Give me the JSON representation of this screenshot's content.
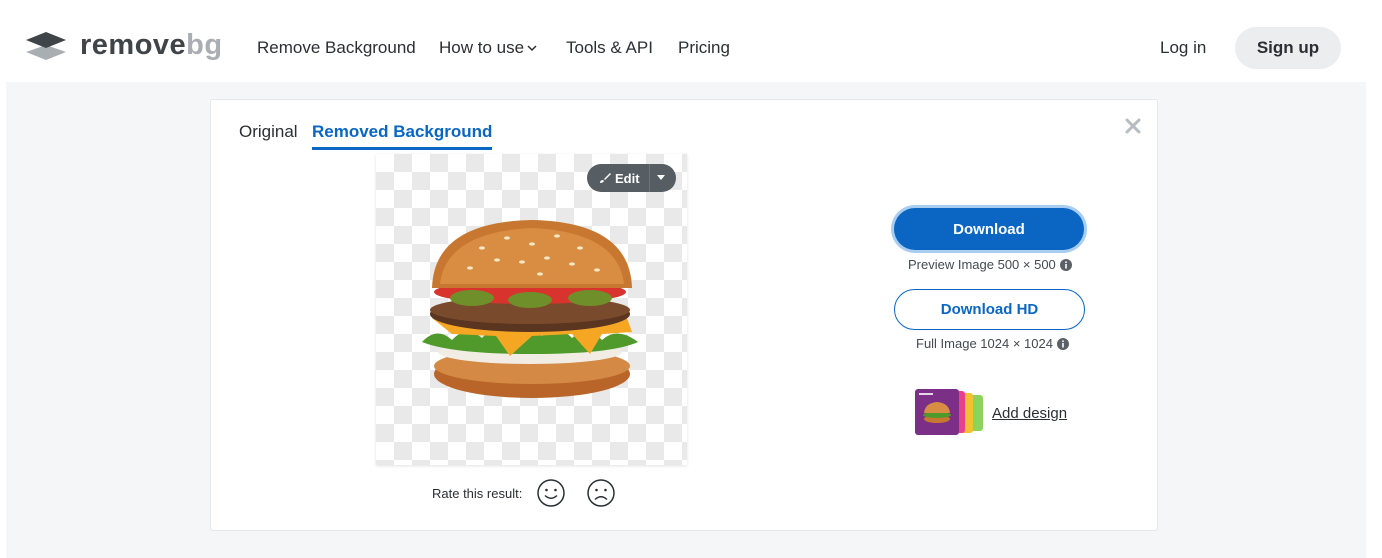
{
  "brand": {
    "word1": "remove",
    "word2": "bg"
  },
  "nav": [
    {
      "label": "Remove Background"
    },
    {
      "label": "How to use"
    },
    {
      "label": "Tools & API"
    },
    {
      "label": "Pricing"
    }
  ],
  "auth": {
    "login": "Log in",
    "signup": "Sign up"
  },
  "tabs": {
    "original": "Original",
    "removed": "Removed Background"
  },
  "editor": {
    "edit_label": "Edit"
  },
  "rating": {
    "label": "Rate this result:"
  },
  "download": {
    "button": "Download",
    "preview_info": "Preview Image 500 × 500",
    "hd_button": "Download HD",
    "hd_info": "Full Image 1024 × 1024"
  },
  "design": {
    "label": "Add design"
  },
  "colors": {
    "primary": "#0a66c2",
    "logo_dark": "#3f4449",
    "logo_light": "#a9aeb3",
    "page_bg": "#f4f6f8"
  },
  "icons": [
    "logo-icon",
    "chevron-down-icon",
    "close-icon",
    "brush-icon",
    "caret-down-icon",
    "smile-icon",
    "frown-icon",
    "info-icon"
  ]
}
